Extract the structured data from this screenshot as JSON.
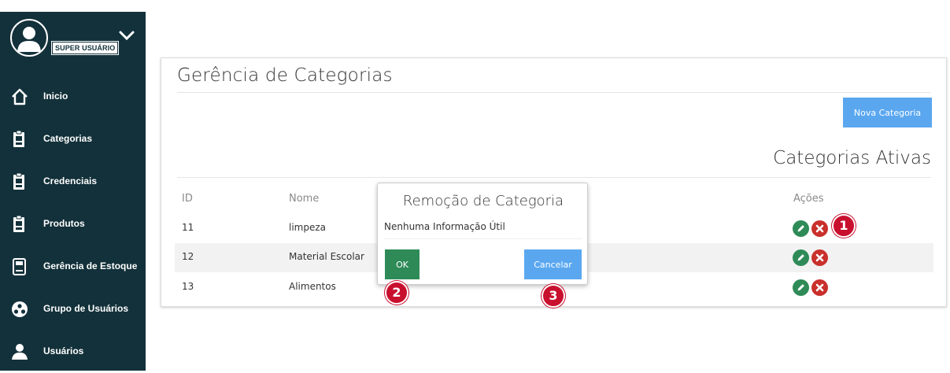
{
  "sidebar": {
    "role_badge": "SUPER USUÁRIO",
    "items": [
      {
        "label": "Inicio",
        "icon": "home-icon"
      },
      {
        "label": "Categorias",
        "icon": "clipboard-icon"
      },
      {
        "label": "Credenciais",
        "icon": "clipboard-icon"
      },
      {
        "label": "Produtos",
        "icon": "clipboard-icon"
      },
      {
        "label": "Gerência de Estoque",
        "icon": "register-icon"
      },
      {
        "label": "Grupo de Usuários",
        "icon": "user-group-icon"
      },
      {
        "label": "Usuários",
        "icon": "user-icon"
      }
    ]
  },
  "main": {
    "title": "Gerência de Categorias",
    "new_button": "Nova Categoria",
    "section_title": "Categorias Ativas",
    "table": {
      "headers": {
        "id": "ID",
        "name": "Nome",
        "actions": "Ações"
      },
      "rows": [
        {
          "id": "11",
          "name": "limpeza"
        },
        {
          "id": "12",
          "name": "Material Escolar"
        },
        {
          "id": "13",
          "name": "Alimentos"
        }
      ]
    }
  },
  "dialog": {
    "title": "Remoção de Categoria",
    "message": "Nenhuma Informação Útil",
    "ok_label": "OK",
    "cancel_label": "Cancelar"
  },
  "markers": [
    "1",
    "2",
    "3"
  ],
  "colors": {
    "sidebar_bg": "#13313a",
    "primary": "#5aa7f0",
    "success": "#2e8b57",
    "danger": "#c9302c",
    "marker": "#c8102e"
  }
}
